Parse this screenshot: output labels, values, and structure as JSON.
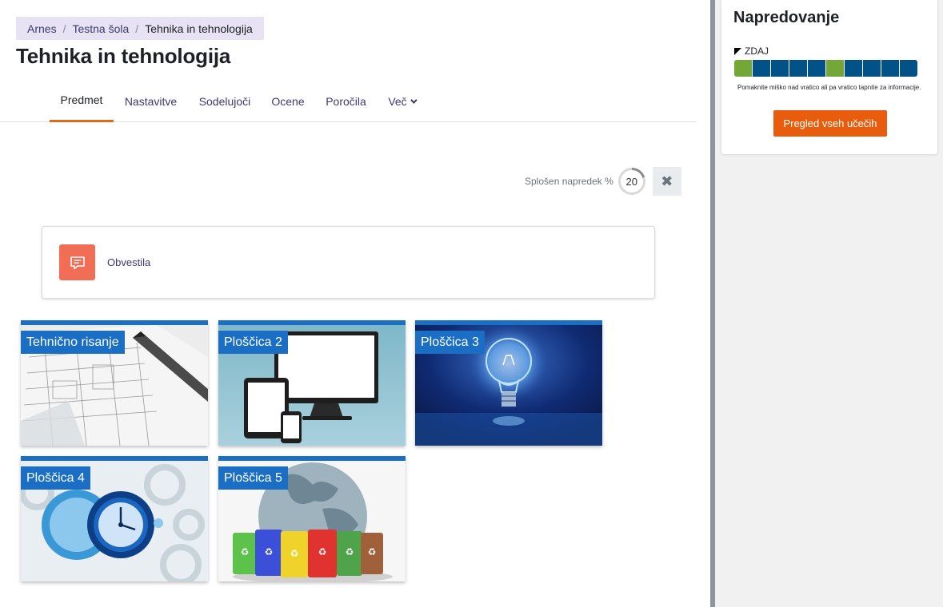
{
  "breadcrumb": {
    "items": [
      "Arnes",
      "Testna šola",
      "Tehnika in tehnologija"
    ]
  },
  "page_title": "Tehnika in tehnologija",
  "tabs": [
    {
      "label": "Predmet",
      "active": true
    },
    {
      "label": "Nastavitve"
    },
    {
      "label": "Sodelujoči"
    },
    {
      "label": "Ocene"
    },
    {
      "label": "Poročila"
    },
    {
      "label": "Več",
      "icon": "chevron-down-icon"
    }
  ],
  "progress": {
    "label": "Splošen napredek %",
    "value": "20",
    "fraction": 0.2
  },
  "announcements": {
    "label": "Obvestila",
    "icon": "forum-icon",
    "icon_color": "#f16d55"
  },
  "tiles": [
    {
      "label": "Tehnično risanje"
    },
    {
      "label": "Ploščica 2"
    },
    {
      "label": "Ploščica 3"
    },
    {
      "label": "Ploščica 4"
    },
    {
      "label": "Ploščica 5"
    }
  ],
  "progress_block": {
    "title": "Napredovanje",
    "now_label": "ZDAJ",
    "cells": [
      "complete",
      "incomplete",
      "incomplete",
      "incomplete",
      "incomplete",
      "complete",
      "incomplete",
      "incomplete",
      "incomplete",
      "incomplete"
    ],
    "hint": "Pomaknite miško nad vratico ali pa vratico tapnite za informacije.",
    "button_label": "Pregled vseh učečih"
  },
  "colors": {
    "accent": "#e06a1b",
    "tile_blue": "#1a6fc4",
    "cell_complete": "#73a839",
    "cell_incomplete": "#025187",
    "button": "#e75d0d"
  }
}
